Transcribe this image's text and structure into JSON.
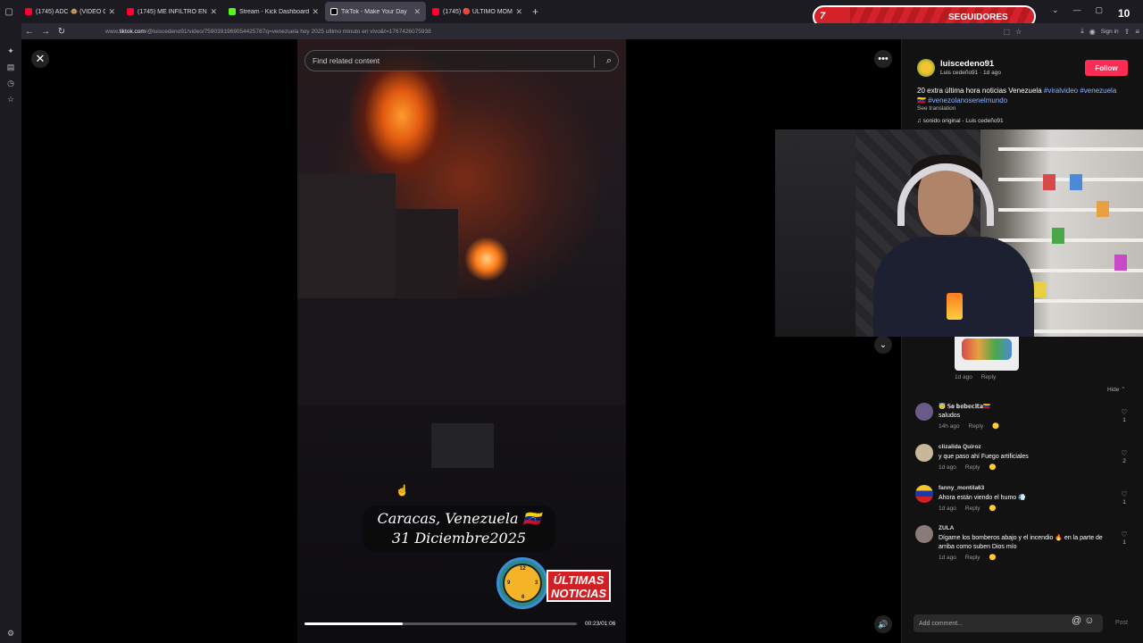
{
  "browser": {
    "tabs": [
      {
        "title": "(1745) ADC 🐵 (VIDEO OFICIAL) ...",
        "color": "#ff0033"
      },
      {
        "title": "(1745) ME INFILTRO EN LAS CASAS ...",
        "color": "#ff0033"
      },
      {
        "title": "Stream - Kick Dashboard",
        "color": "#53fc18"
      },
      {
        "title": "TikTok - Make Your Day",
        "color": "#ffffff"
      },
      {
        "title": "(1745) 🔴 ÚLTIMO MOMENTO | ...",
        "color": "#ff0033"
      }
    ],
    "url_prefix": "www.",
    "url_domain": "tiktok.com",
    "url_path": "/@luiscedeno91/video/7590391969054425787q=venezuela hoy 2025 ultimo minuto en vivo&t=1767426075938",
    "sign_in": "Sign in"
  },
  "overlay": {
    "followers_count": "7",
    "followers_label": "SEGUIDORES",
    "followers_goal": "10"
  },
  "video": {
    "search_placeholder": "Find related content",
    "caption_line1": "Caracas, Venezuela 🇻🇪",
    "caption_line2": "31 Diciembre2025",
    "badge_line1": "ÚLTIMAS",
    "badge_line2": "NOTICIAS",
    "time": "00:23/01:06",
    "progress": 0.36
  },
  "post": {
    "username": "luiscedeno91",
    "display": "Luis cedeño91 · 1d ago",
    "follow": "Follow",
    "desc_text": "20 extra última hora noticias Venezuela ",
    "tag1": "#viralvideo",
    "tag2": "#venezuela🇻🇪",
    "tag3": "#venezolanosenelmundo",
    "see_translation": "See translation",
    "sound": "♫  sonido original - Luis cedeño91"
  },
  "comments_top": {
    "meta_time": "1d ago",
    "meta_reply": "Reply",
    "hide": "Hide ⌃"
  },
  "comments": [
    {
      "user": "😇 𝕊𝕠 𝕓𝕖𝕓𝕖𝕔𝕚𝕥𝕒🇻🇪",
      "text": "saludos",
      "time": "14h ago",
      "reply": "Reply",
      "likes": "1",
      "avatar": "#6a5a8a"
    },
    {
      "user": "clizalida Quiroz",
      "text": "y que paso ahí Fuego artificiales",
      "time": "1d ago",
      "reply": "Reply",
      "likes": "2",
      "avatar": "#c8b89a"
    },
    {
      "user": "fanny_montila63",
      "text": "Ahora están viendo el humo 💨",
      "time": "1d ago",
      "reply": "Reply",
      "likes": "1",
      "avatar": "#f4c430"
    },
    {
      "user": "ZULA",
      "text": "Dígame los bomberos abajo y el incendio 🔥 en la parte de arriba como suben Dios mío",
      "time": "1d ago",
      "reply": "Reply",
      "likes": "1",
      "avatar": "#8a7a7a"
    }
  ],
  "composer": {
    "placeholder": "Add comment...",
    "post": "Post"
  }
}
